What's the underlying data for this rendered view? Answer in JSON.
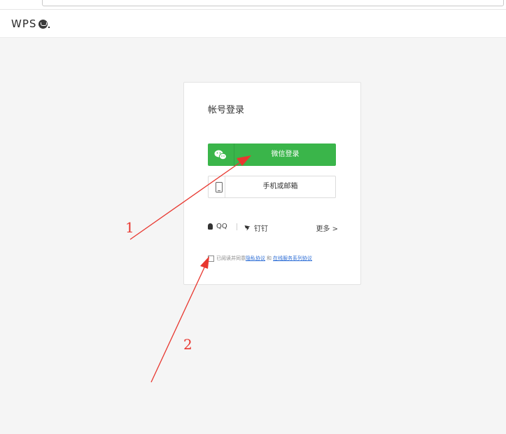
{
  "header": {
    "logo_text": "WPS"
  },
  "login_card": {
    "title": "帐号登录",
    "wechat_button_label": "微信登录",
    "phone_email_button_label": "手机或邮箱",
    "alt_login": {
      "qq_label": "QQ",
      "dingtalk_label": "钉钉",
      "more_label": "更多 >"
    },
    "agreement": {
      "prefix": "已阅读并同意",
      "privacy_link": "隐私协议",
      "and": "和",
      "service_link": "在线服务系列协议",
      "checked": false
    }
  },
  "annotations": {
    "label_1": "1",
    "label_2": "2",
    "color": "#e8372f"
  },
  "colors": {
    "wechat_green": "#3ab54a",
    "link_blue": "#2f6fd6",
    "page_bg": "#f5f5f5"
  }
}
